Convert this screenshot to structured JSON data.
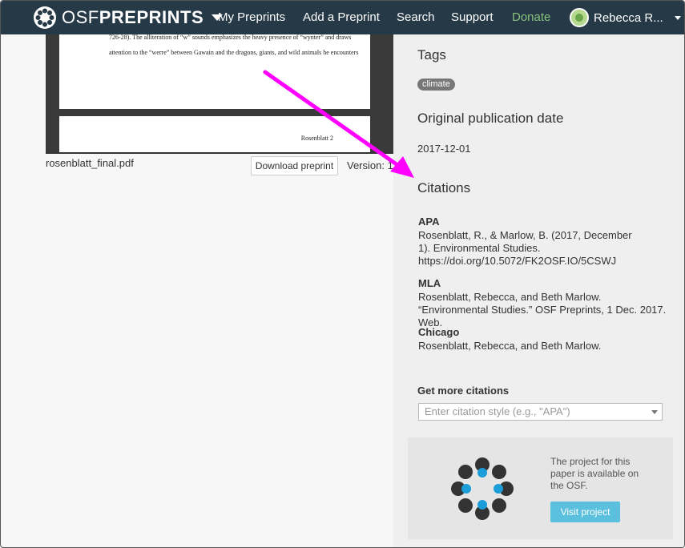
{
  "navbar": {
    "brand_light": "OSF",
    "brand_bold": "PREPRINTS",
    "links": {
      "my_preprints": "My Preprints",
      "add_preprint": "Add a Preprint",
      "search": "Search",
      "support": "Support",
      "donate": "Donate"
    },
    "user_name": "Rebecca R...",
    "donate_color": "#88c27c",
    "background_color": "#263947"
  },
  "document": {
    "line1": "726-28). The alliteration of “w” sounds emphasizes the heavy presence of “wynter” and draws",
    "line2": "attention to the “werre” between Gawain and the dragons, giants, and wild animals he encounters",
    "page2_header": "Rosenblatt 2",
    "filename": "rosenblatt_final.pdf",
    "download_label": "Download preprint",
    "version_label": "Version: 1"
  },
  "sidebar": {
    "tags_title": "Tags",
    "tags": [
      "climate"
    ],
    "pub_date_title": "Original publication date",
    "pub_date": "2017-12-01",
    "citations_title": "Citations",
    "citations": [
      {
        "style": "APA",
        "text": "Rosenblatt, R., & Marlow, B. (2017, December 1). Environmental Studies. https://doi.org/10.5072/FK2OSF.IO/5CSWJ"
      },
      {
        "style": "MLA",
        "text": "Rosenblatt, Rebecca, and Beth Marlow. “Environmental Studies.” OSF Preprints, 1 Dec. 2017. Web."
      },
      {
        "style": "Chicago",
        "text": "Rosenblatt, Rebecca, and Beth Marlow."
      }
    ],
    "more_citations_label": "Get more citations",
    "citation_select_placeholder": "Enter citation style (e.g., \"APA\")",
    "project_text": "The project for this paper is available on the OSF.",
    "visit_project_label": "Visit project",
    "visit_button_color": "#5bc0de"
  },
  "annotation": {
    "arrow_color": "#ff00ff"
  }
}
